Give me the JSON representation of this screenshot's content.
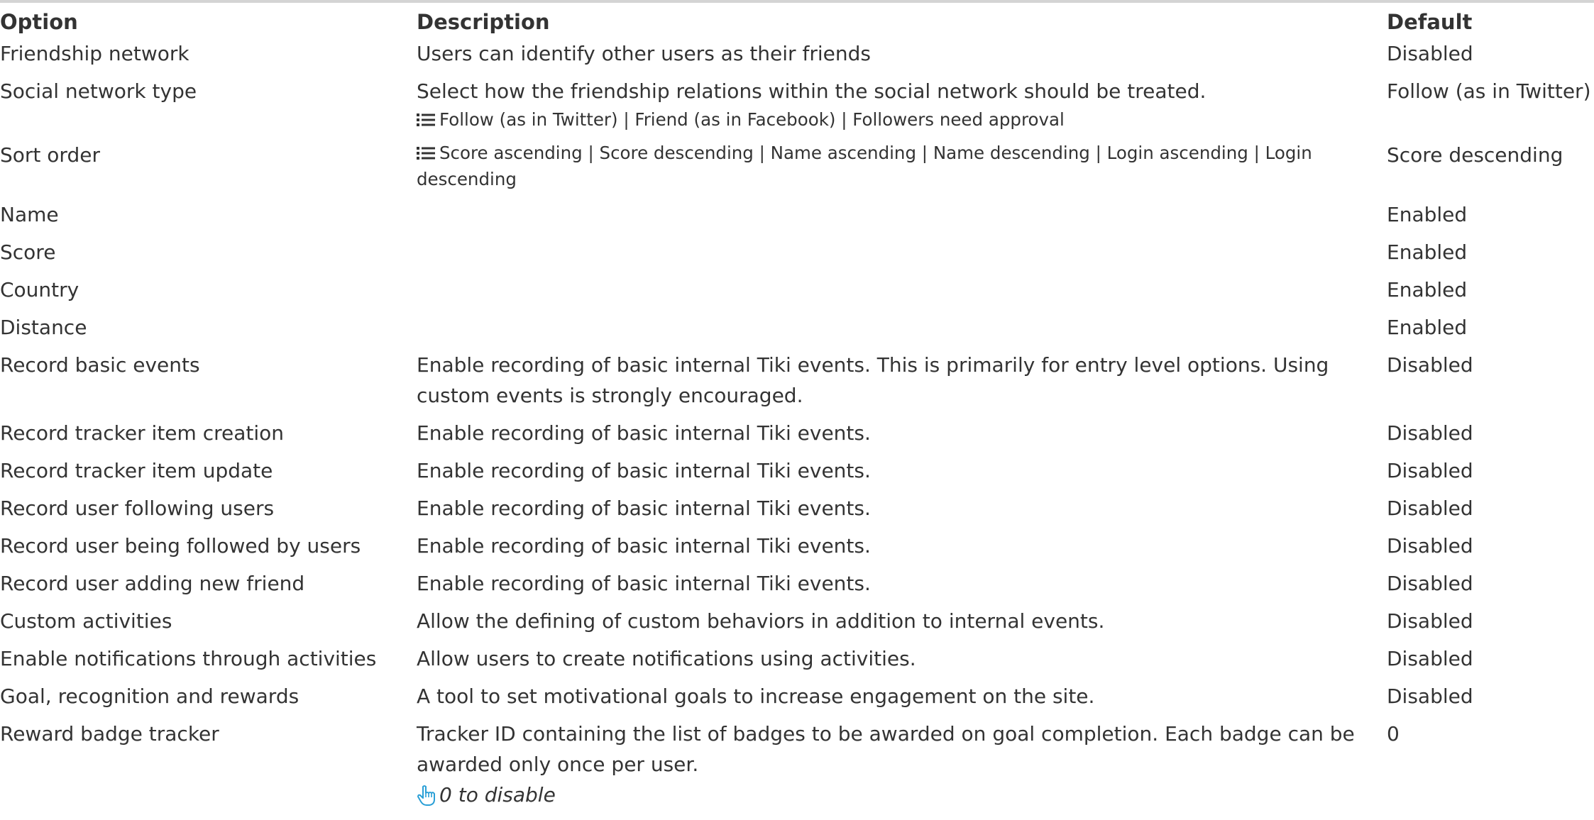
{
  "headers": {
    "option": "Option",
    "description": "Description",
    "default": "Default"
  },
  "rows": [
    {
      "option": "Friendship network",
      "description": "Users can identify other users as their friends",
      "options_list": "",
      "hint": "",
      "default": "Disabled"
    },
    {
      "option": "Social network type",
      "description": "Select how the friendship relations within the social network should be treated.",
      "options_list": "Follow (as in Twitter) | Friend (as in Facebook) | Followers need approval",
      "hint": "",
      "default": "Follow (as in Twitter)"
    },
    {
      "option": "Sort order",
      "description": "",
      "options_list": "Score ascending | Score descending | Name ascending | Name descending | Login ascending | Login descending",
      "hint": "",
      "default": "Score descending"
    },
    {
      "option": "Name",
      "description": "",
      "options_list": "",
      "hint": "",
      "default": "Enabled"
    },
    {
      "option": "Score",
      "description": "",
      "options_list": "",
      "hint": "",
      "default": "Enabled"
    },
    {
      "option": "Country",
      "description": "",
      "options_list": "",
      "hint": "",
      "default": "Enabled"
    },
    {
      "option": "Distance",
      "description": "",
      "options_list": "",
      "hint": "",
      "default": "Enabled"
    },
    {
      "option": "Record basic events",
      "description": "Enable recording of basic internal Tiki events. This is primarily for entry level options. Using custom events is strongly encouraged.",
      "options_list": "",
      "hint": "",
      "default": "Disabled"
    },
    {
      "option": "Record tracker item creation",
      "description": "Enable recording of basic internal Tiki events.",
      "options_list": "",
      "hint": "",
      "default": "Disabled"
    },
    {
      "option": "Record tracker item update",
      "description": "Enable recording of basic internal Tiki events.",
      "options_list": "",
      "hint": "",
      "default": "Disabled"
    },
    {
      "option": "Record user following users",
      "description": "Enable recording of basic internal Tiki events.",
      "options_list": "",
      "hint": "",
      "default": "Disabled"
    },
    {
      "option": "Record user being followed by users",
      "description": "Enable recording of basic internal Tiki events.",
      "options_list": "",
      "hint": "",
      "default": "Disabled"
    },
    {
      "option": "Record user adding new friend",
      "description": "Enable recording of basic internal Tiki events.",
      "options_list": "",
      "hint": "",
      "default": "Disabled"
    },
    {
      "option": "Custom activities",
      "description": "Allow the defining of custom behaviors in addition to internal events.",
      "options_list": "",
      "hint": "",
      "default": "Disabled"
    },
    {
      "option": "Enable notifications through activities",
      "description": "Allow users to create notifications using activities.",
      "options_list": "",
      "hint": "",
      "default": "Disabled"
    },
    {
      "option": "Goal, recognition and rewards",
      "description": "A tool to set motivational goals to increase engagement on the site.",
      "options_list": "",
      "hint": "",
      "default": "Disabled"
    },
    {
      "option": "Reward badge tracker",
      "description": "Tracker ID containing the list of badges to be awarded on goal completion. Each badge can be awarded only once per user.",
      "options_list": "",
      "hint": "0 to disable",
      "default": "0"
    }
  ],
  "icons": {
    "options_list": "list-icon",
    "hint": "pointing-hand-icon"
  },
  "colors": {
    "text": "#333333",
    "hint_icon": "#2a9fd6",
    "top_rule": "#d4d4d4"
  }
}
